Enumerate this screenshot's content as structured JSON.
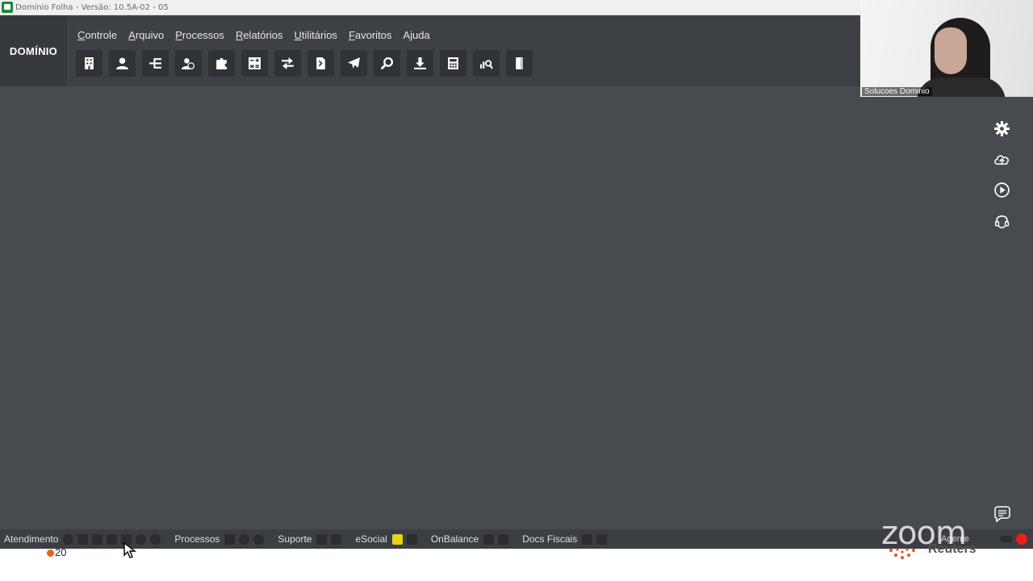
{
  "window": {
    "title": "Domínio Folha - Versão: 10.5A-02 - 05"
  },
  "brand": {
    "logo_text": "DOMÍNIO"
  },
  "menu": [
    {
      "underline": "C",
      "rest": "ontrole"
    },
    {
      "underline": "A",
      "rest": "rquivo"
    },
    {
      "underline": "P",
      "rest": "rocessos"
    },
    {
      "underline": "R",
      "rest": "elatórios"
    },
    {
      "underline": "U",
      "rest": "tilitários"
    },
    {
      "underline": "F",
      "rest": "avoritos"
    },
    {
      "underline": "",
      "rest": "Ajuda"
    }
  ],
  "toolbar_icons": [
    "building-icon",
    "employee-icon",
    "tree-icon",
    "user-search-icon",
    "puzzle-icon",
    "calculator-sheet-icon",
    "transfer-icon",
    "document-icon",
    "airplane-icon",
    "search-icon",
    "download-icon",
    "calculator-icon",
    "chart-search-icon",
    "door-icon"
  ],
  "video": {
    "participant_name": "Solucoes Dominio"
  },
  "side_icons": [
    "gear-icon",
    "cloud-upload-icon",
    "play-icon",
    "headset-icon"
  ],
  "statusbar": {
    "atendimento": "Atendimento",
    "processos": "Processos",
    "suporte": "Suporte",
    "esocial": "eSocial",
    "onbalance": "OnBalance",
    "docs_fiscais": "Docs Fiscais",
    "agente": "Agente"
  },
  "overlay": {
    "zoom_logo": "zoom",
    "reuters_text": "Reuters",
    "count": "20"
  },
  "colors": {
    "frame": "#474a4f",
    "header": "#3d4045",
    "logo_bg": "#35383c",
    "status_red": "#e6201a",
    "esocial_yellow": "#e7d218"
  }
}
